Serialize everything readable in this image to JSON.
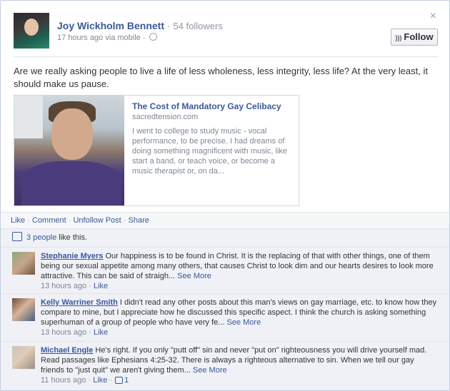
{
  "post": {
    "author": "Joy Wickholm Bennett",
    "followers": "54 followers",
    "time": "17 hours ago via mobile",
    "follow_label": "Follow",
    "close_glyph": "×",
    "status_text": "Are we really asking people to live a life of less wholeness, less integrity, less life? At the very least, it should make us pause."
  },
  "share": {
    "title": "The Cost of Mandatory Gay Celibacy",
    "site": "sacredtension.com",
    "description": "I went to college to study music - vocal performance, to be precise. I had dreams of doing something magnificent with music, like start a band, or teach voice, or become a music therapist or, on da..."
  },
  "actions": {
    "like": "Like",
    "comment": "Comment",
    "unfollow": "Unfollow Post",
    "share": "Share"
  },
  "likes": {
    "people": "3 people",
    "suffix": " like this."
  },
  "comments": [
    {
      "name": "Stephanie Myers",
      "text": " Our happiness is to be found in Christ. It is the replacing of that with other things, one of them being our sexual appetite among many others, that causes Christ to look dim and our hearts desires to look more attractive. This can be said of straigh...",
      "see_more": "See More",
      "time": "13 hours ago",
      "like": "Like",
      "like_count": ""
    },
    {
      "name": "Kelly Warriner Smith",
      "text": " I didn't read any other posts about this man's views on gay marriage, etc. to know how they compare to mine, but I appreciate how he discussed this specific aspect. I think the church is asking something superhuman of a group of people who have very fe...",
      "see_more": "See More",
      "time": "13 hours ago",
      "like": "Like",
      "like_count": ""
    },
    {
      "name": "Michael Engle",
      "text": " He's right. If you only \"putt off\" sin and never \"put on\" righteousness you will drive yourself mad. Read passages like Ephesians 4:25-32. There is always a righteous alternative to sin. When we tell our gay friends to \"just quit\" we aren't giving them...",
      "see_more": "See More",
      "time": "11 hours ago",
      "like": "Like",
      "like_count": "1"
    }
  ],
  "colors": {
    "link": "#3b5998",
    "meta": "#7f8694",
    "comment_bg": "#eff1f6"
  }
}
